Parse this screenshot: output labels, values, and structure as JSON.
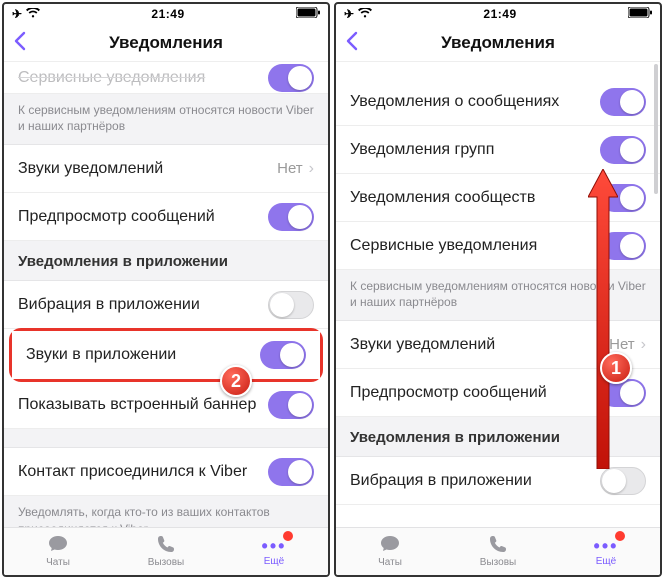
{
  "status": {
    "time": "21:49"
  },
  "title": "Уведомления",
  "left": {
    "partial_row": "Сервисные уведомления",
    "note1": "К сервисным уведомлениям относятся новости Viber и наших партнёров",
    "sound_label": "Звуки уведомлений",
    "sound_value": "Нет",
    "preview": "Предпросмотр сообщений",
    "section_inapp": "Уведомления в приложении",
    "vibra": "Вибрация в приложении",
    "sounds_inapp": "Звуки в приложении",
    "banner": "Показывать встроенный баннер",
    "contact_joined": "Контакт присоединился к Viber",
    "note2": "Уведомлять, когда кто-то из ваших контактов присоединяется к Viber"
  },
  "right": {
    "msg": "Уведомления о сообщениях",
    "groups": "Уведомления групп",
    "comm": "Уведомления сообществ",
    "service": "Сервисные уведомления",
    "note1": "К сервисным уведомлениям относятся новости Viber и наших партнёров",
    "sound_label": "Звуки уведомлений",
    "sound_value": "Нет",
    "preview": "Предпросмотр сообщений",
    "section_inapp": "Уведомления в приложении",
    "vibra": "Вибрация в приложении"
  },
  "tabs": {
    "chats": "Чаты",
    "calls": "Вызовы",
    "more": "Ещё"
  },
  "steps": {
    "one": "1",
    "two": "2"
  }
}
